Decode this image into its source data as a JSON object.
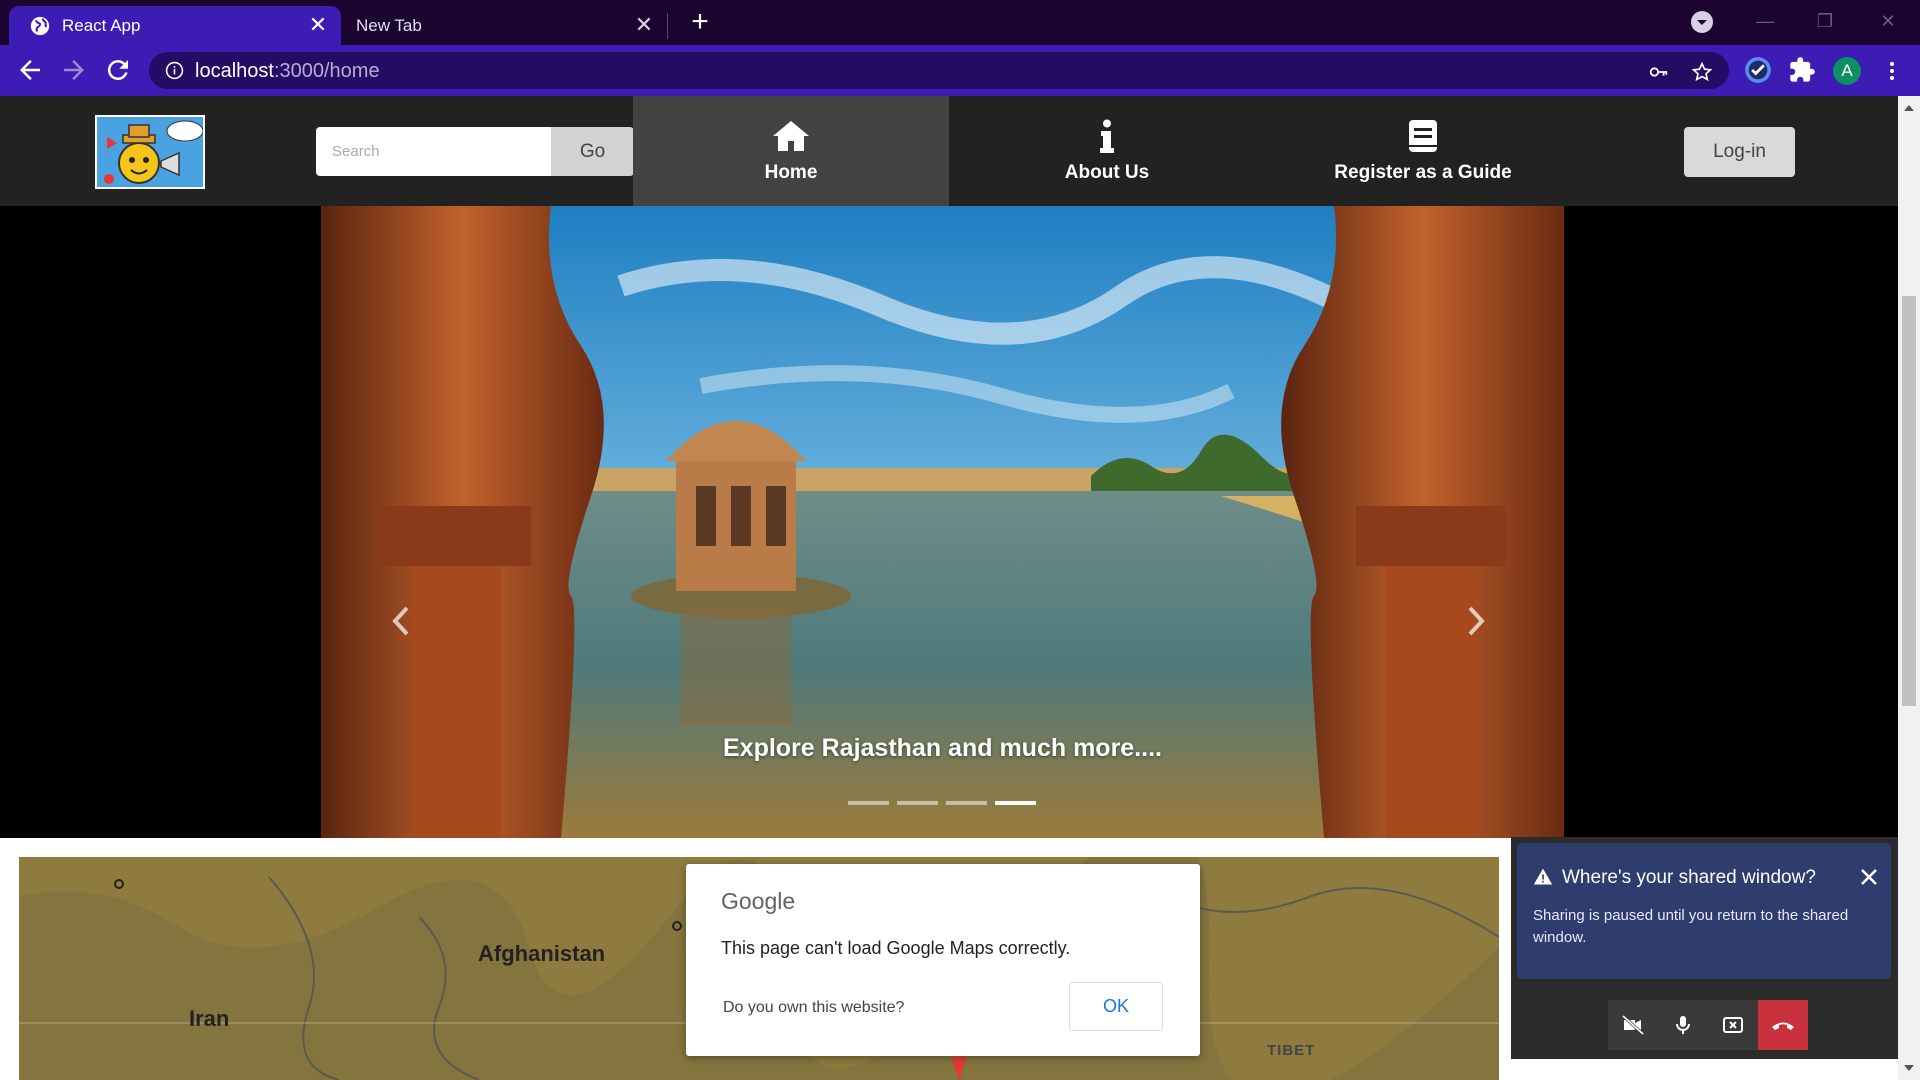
{
  "browser": {
    "tabs": [
      {
        "title": "React App",
        "active": true
      },
      {
        "title": "New Tab",
        "active": false
      }
    ],
    "url_host": "localhost",
    "url_path": ":3000/home",
    "avatar_letter": "A",
    "accent": "#3d1cb6",
    "tabbar_color": "#1b0530"
  },
  "site": {
    "search_placeholder": "Search",
    "go_label": "Go",
    "nav": [
      {
        "label": "Home",
        "icon": "home-icon",
        "active": true
      },
      {
        "label": "About Us",
        "icon": "info-icon",
        "active": false
      },
      {
        "label": "Register as a Guide",
        "icon": "book-icon",
        "active": false
      }
    ],
    "login_label": "Log-in"
  },
  "carousel": {
    "caption": "Explore Rajasthan and much more....",
    "slide_count": 4,
    "active_slide": 4
  },
  "map": {
    "labels": [
      "Afghanistan",
      "Iran",
      "TIBET"
    ],
    "dialog": {
      "brand": "Google",
      "message": "This page can't load Google Maps correctly.",
      "question": "Do you own this website?",
      "ok_label": "OK"
    }
  },
  "share_popup": {
    "title": "Where's your shared window?",
    "body": "Sharing is paused until you return to the shared window.",
    "hangup_color": "#c8313c"
  }
}
